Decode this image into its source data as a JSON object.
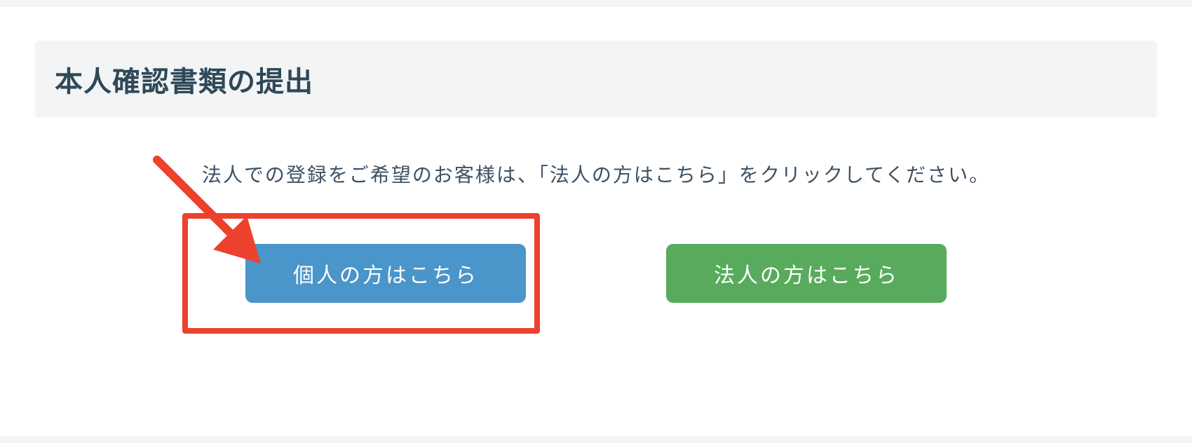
{
  "title": "本人確認書類の提出",
  "instruction": "法人での登録をご希望のお客様は、「法人の方はこちら」をクリックしてください。",
  "buttons": {
    "individual": "個人の方はこちら",
    "corporate": "法人の方はこちら"
  }
}
